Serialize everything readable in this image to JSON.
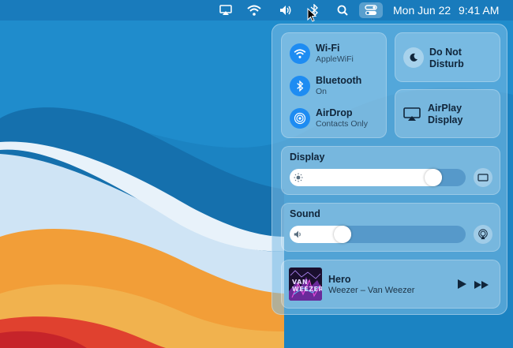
{
  "menubar": {
    "airplay_icon": "airplay-icon",
    "wifi_icon": "wifi-icon",
    "volume_icon": "volume-icon",
    "bluetooth_icon": "bluetooth-icon",
    "search_icon": "search-icon",
    "control_center_icon": "control-center-icon",
    "date": "Mon Jun 22",
    "time": "9:41 AM"
  },
  "control_center": {
    "connectivity": [
      {
        "title": "Wi-Fi",
        "subtitle": "AppleWiFi",
        "icon": "wifi-icon",
        "active": true
      },
      {
        "title": "Bluetooth",
        "subtitle": "On",
        "icon": "bluetooth-icon",
        "active": true
      },
      {
        "title": "AirDrop",
        "subtitle": "Contacts Only",
        "icon": "airdrop-icon",
        "active": true
      }
    ],
    "do_not_disturb": {
      "label_line1": "Do Not",
      "label_line2": "Disturb",
      "icon": "moon-icon"
    },
    "airplay_display": {
      "label_line1": "AirPlay",
      "label_line2": "Display",
      "icon": "airplay-display-icon"
    },
    "display": {
      "title": "Display",
      "brightness": 0.85,
      "icon": "sun-icon",
      "button_icon": "display-icon"
    },
    "sound": {
      "title": "Sound",
      "volume": 0.28,
      "icon": "speaker-icon",
      "button_icon": "airplay-audio-icon"
    },
    "now_playing": {
      "title": "Hero",
      "artist": "Weezer – Van Weezer",
      "art_text": "VAN WEEZER",
      "play_icon": "play-icon",
      "next_icon": "fast-forward-icon"
    }
  },
  "colors": {
    "accent": "#1e8cf2",
    "wallpaper_blue": "#1f87c4",
    "wallpaper_orange": "#f2a13a"
  }
}
